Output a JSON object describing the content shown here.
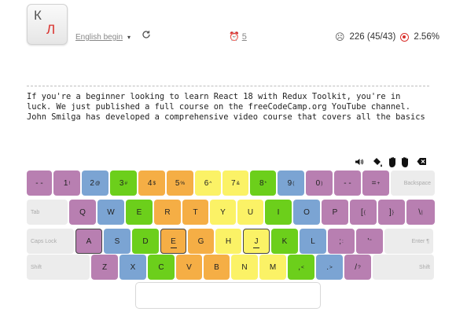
{
  "colors": {
    "mauve": "#b87fb1",
    "blue": "#7ba4d3",
    "green": "#6ccf1b",
    "orange": "#f5ae45",
    "yellow": "#fbf266",
    "gray": "#ececec",
    "accent_red": "#d9302c"
  },
  "header": {
    "logo_letters": [
      "К",
      "Л"
    ],
    "language_label": "English begin",
    "language_caret": "▾",
    "reload_icon": "reload-icon",
    "timer_value": "5",
    "stats_text": "226 (45/43)",
    "error_rate": "2.56%"
  },
  "lesson": {
    "lines": [
      "If you're a beginner looking to learn React 18 with Redux Toolkit, you're in",
      "luck. We just published a full course on the freeCodeCamp.org YouTube channel.",
      "John Smilga has developed a comprehensive video course that covers all the basics"
    ]
  },
  "toolbar": {
    "icons": [
      "volume-icon",
      "fill-icon",
      "hands-icon",
      "backspace-icon"
    ]
  },
  "keyboard": {
    "rows": [
      [
        {
          "main": "- -",
          "sup": "",
          "color": "mauve",
          "width": 32
        },
        {
          "main": "1",
          "sup": "!",
          "color": "mauve",
          "width": 34
        },
        {
          "main": "2",
          "sup": "@",
          "color": "blue",
          "width": 34
        },
        {
          "main": "3",
          "sup": "#",
          "color": "green",
          "width": 34
        },
        {
          "main": "4",
          "sup": "$",
          "color": "orange",
          "width": 34
        },
        {
          "main": "5",
          "sup": "%",
          "color": "orange",
          "width": 34
        },
        {
          "main": "6",
          "sup": "^",
          "color": "yellow",
          "width": 33
        },
        {
          "main": "7",
          "sup": "&",
          "color": "yellow",
          "width": 33
        },
        {
          "main": "8",
          "sup": "*",
          "color": "green",
          "width": 33
        },
        {
          "main": "9",
          "sup": "(",
          "color": "blue",
          "width": 34
        },
        {
          "main": "0",
          "sup": ")",
          "color": "mauve",
          "width": 34
        },
        {
          "main": "- -",
          "sup": "",
          "color": "mauve",
          "width": 34
        },
        {
          "main": "=",
          "sup": "+",
          "color": "mauve",
          "width": 34
        },
        {
          "main": "Backspace",
          "sup": "",
          "color": "gray",
          "width": 56,
          "func": "right"
        }
      ],
      [
        {
          "main": "Tab",
          "sup": "",
          "color": "gray",
          "width": 52,
          "func": "left"
        },
        {
          "main": "Q",
          "sup": "",
          "color": "mauve",
          "width": 34
        },
        {
          "main": "W",
          "sup": "",
          "color": "blue",
          "width": 34
        },
        {
          "main": "E",
          "sup": "",
          "color": "green",
          "width": 34
        },
        {
          "main": "R",
          "sup": "",
          "color": "orange",
          "width": 34
        },
        {
          "main": "T",
          "sup": "",
          "color": "orange",
          "width": 33
        },
        {
          "main": "Y",
          "sup": "",
          "color": "yellow",
          "width": 33
        },
        {
          "main": "U",
          "sup": "",
          "color": "yellow",
          "width": 33
        },
        {
          "main": "I",
          "sup": "",
          "color": "green",
          "width": 34
        },
        {
          "main": "O",
          "sup": "",
          "color": "blue",
          "width": 34
        },
        {
          "main": "P",
          "sup": "",
          "color": "mauve",
          "width": 34
        },
        {
          "main": "[",
          "sup": "{",
          "color": "mauve",
          "width": 34
        },
        {
          "main": "]",
          "sup": "}",
          "color": "mauve",
          "width": 34
        },
        {
          "main": "\\",
          "sup": "|",
          "color": "mauve",
          "width": 36
        }
      ],
      [
        {
          "main": "Caps Lock",
          "sup": "",
          "color": "gray",
          "width": 60,
          "func": "left"
        },
        {
          "main": "A",
          "sup": "",
          "color": "mauve",
          "width": 34,
          "outlined": true
        },
        {
          "main": "S",
          "sup": "",
          "color": "blue",
          "width": 34
        },
        {
          "main": "D",
          "sup": "",
          "color": "green",
          "width": 34
        },
        {
          "main": "E",
          "sup": "",
          "color": "orange",
          "width": 33,
          "outlined": true,
          "bar": true
        },
        {
          "main": "G",
          "sup": "",
          "color": "orange",
          "width": 33
        },
        {
          "main": "H",
          "sup": "",
          "color": "yellow",
          "width": 33
        },
        {
          "main": "J",
          "sup": "",
          "color": "yellow",
          "width": 34,
          "outlined": true,
          "bar": true
        },
        {
          "main": "K",
          "sup": "",
          "color": "green",
          "width": 34
        },
        {
          "main": "L",
          "sup": "",
          "color": "blue",
          "width": 34
        },
        {
          "main": ";",
          "sup": ":",
          "color": "mauve",
          "width": 34
        },
        {
          "main": "'",
          "sup": "\"",
          "color": "mauve",
          "width": 34
        },
        {
          "main": "Enter ¶",
          "sup": "",
          "color": "gray",
          "width": 62,
          "func": "right"
        }
      ],
      [
        {
          "main": "Shift",
          "sup": "",
          "color": "gray",
          "width": 80,
          "func": "left"
        },
        {
          "main": "Z",
          "sup": "",
          "color": "mauve",
          "width": 34
        },
        {
          "main": "X",
          "sup": "",
          "color": "blue",
          "width": 34
        },
        {
          "main": "C",
          "sup": "",
          "color": "green",
          "width": 34
        },
        {
          "main": "V",
          "sup": "",
          "color": "orange",
          "width": 33
        },
        {
          "main": "B",
          "sup": "",
          "color": "orange",
          "width": 33
        },
        {
          "main": "N",
          "sup": "",
          "color": "yellow",
          "width": 34
        },
        {
          "main": "M",
          "sup": "",
          "color": "yellow",
          "width": 34
        },
        {
          "main": ",",
          "sup": "<",
          "color": "green",
          "width": 34
        },
        {
          "main": ".",
          "sup": ">",
          "color": "blue",
          "width": 34
        },
        {
          "main": "/",
          "sup": "?",
          "color": "mauve",
          "width": 34
        },
        {
          "main": "Shift",
          "sup": "",
          "color": "gray",
          "width": 78,
          "func": "right"
        }
      ]
    ]
  }
}
